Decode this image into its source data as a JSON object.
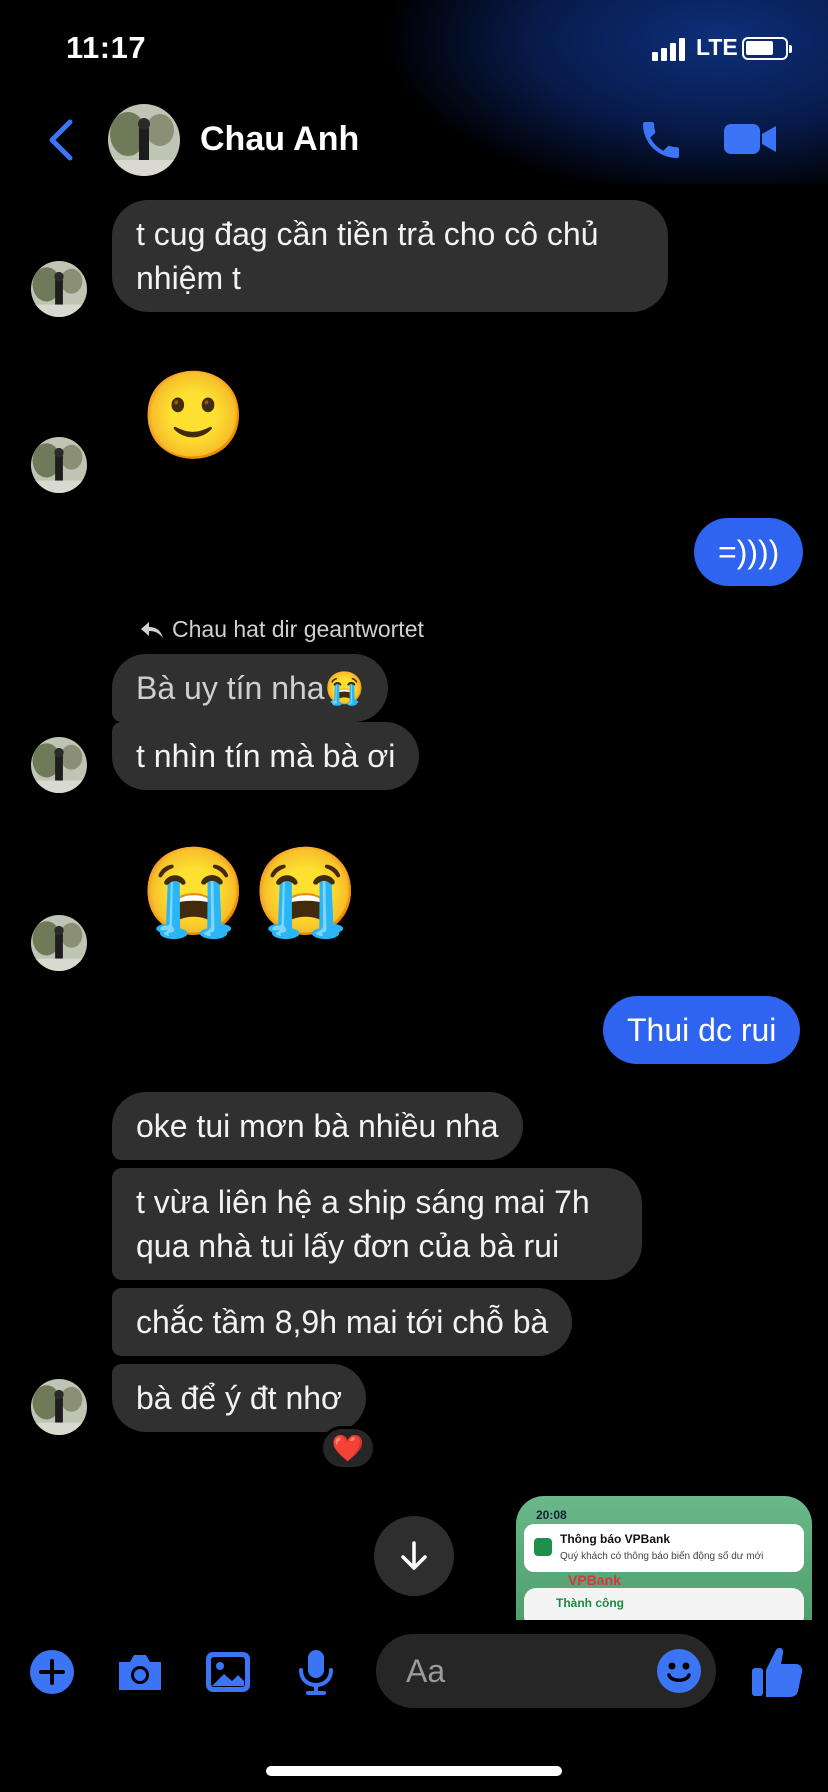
{
  "status_bar": {
    "time": "11:17",
    "network": "LTE",
    "battery_percent": 70
  },
  "header": {
    "contact_name": "Chau Anh",
    "back_icon": "chevron-left-icon",
    "call_icon": "phone-icon",
    "video_icon": "video-camera-icon"
  },
  "messages": {
    "m1": "t cug đag cần tiền trả cho cô chủ nhiệm t",
    "m2_emoji": "🙂",
    "m3_mine": "=))))",
    "reply_note": "Chau hat dir geantwortet",
    "m4_quoted": "Bà uy tín nha😭",
    "m5": "t nhìn tín mà bà ơi",
    "m6_emoji_a": "😭",
    "m6_emoji_b": "😭",
    "m7_mine": "Thui dc rui",
    "m8": "oke tui mơn bà nhiều nha",
    "m9": "t vừa liên hệ a ship sáng mai 7h qua nhà tui lấy đơn của bà rui",
    "m10": "chắc tầm 8,9h mai tới chỗ bà",
    "m11": "bà để ý đt nhơ",
    "m11_reaction": "❤️"
  },
  "shared_image": {
    "time": "20:08",
    "notification_title": "Thông báo VPBank",
    "notification_body": "Quý khách có thông báo biến động số dư mới",
    "brand": "VPBank",
    "status": "Thành công"
  },
  "composer": {
    "placeholder": "Aa"
  },
  "colors": {
    "accent": "#2f64f0",
    "bubble_other": "#303030",
    "icon_blue": "#3b74f5"
  }
}
